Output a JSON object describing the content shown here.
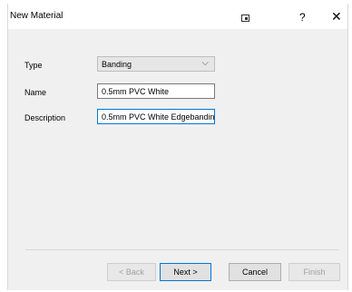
{
  "window": {
    "title": "New Material"
  },
  "titlebar": {
    "help": "?",
    "close": "✕"
  },
  "form": {
    "type_label": "Type",
    "type_value": "Banding",
    "name_label": "Name",
    "name_value": "0.5mm PVC White",
    "description_label": "Description",
    "description_value": "0.5mm PVC White Edgebandin"
  },
  "buttons": {
    "back": "< Back",
    "next": "Next >",
    "cancel": "Cancel",
    "finish": "Finish"
  },
  "icons": [
    "restore-icon",
    "help-icon",
    "close-icon",
    "chevron-down-icon"
  ]
}
